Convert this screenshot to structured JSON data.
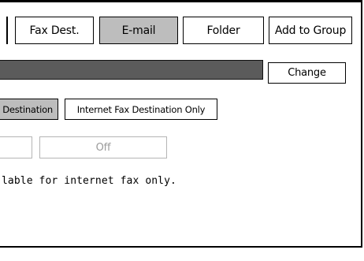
{
  "tabs": {
    "fax_dest": "Fax Dest.",
    "email": "E-mail",
    "folder": "Folder",
    "add_to_group": "Add to Group"
  },
  "name_field": {
    "value": "",
    "change_label": "Change"
  },
  "destination_type": {
    "option_partial": "Destination",
    "internet_fax_only": "Internet Fax Destination Only"
  },
  "toggle": {
    "on_label": "",
    "off_label": "Off"
  },
  "info": {
    "message": "lable for internet fax only."
  },
  "colors": {
    "selected_tab": "#bdbdbd",
    "name_bar": "#5b5b5b"
  }
}
